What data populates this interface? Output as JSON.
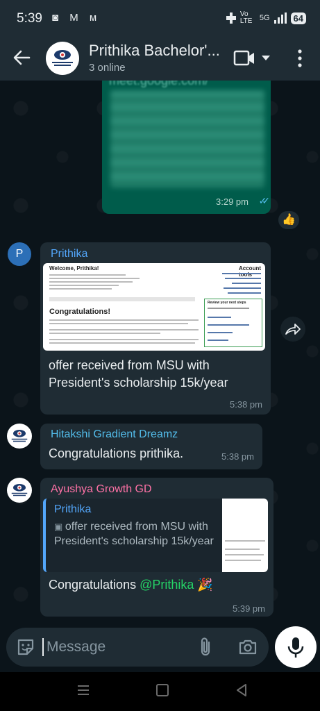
{
  "status_bar": {
    "time": "5:39",
    "left_icons": "◙ M ᴍ",
    "signal_text": "Vo LTE",
    "network": "5G",
    "battery": "64"
  },
  "header": {
    "title": "Prithika Bachelor'...",
    "subtitle": "3 online",
    "avatar_text": "GRADIENT DREAMZ"
  },
  "messages": [
    {
      "type": "outgoing",
      "link_text": "meet.google.com/",
      "time": "3:29 pm",
      "reaction": "👍"
    },
    {
      "type": "incoming",
      "avatar_letter": "P",
      "sender": "Prithika",
      "sender_color": "#53a6fa",
      "preview": {
        "title": "Welcome, Prithika!",
        "headline": "Congratulations!",
        "side_title": "Account tools",
        "box_title": "Review your next steps"
      },
      "text": "offer received from MSU with President's scholarship 15k/year",
      "time": "5:38 pm"
    },
    {
      "type": "incoming",
      "sender": "Hitakshi Gradient Dreamz",
      "sender_color": "#53bdeb",
      "text": "Congratulations prithika.",
      "time": "5:38 pm"
    },
    {
      "type": "incoming",
      "sender": "Ayushya Growth GD",
      "sender_color": "#ff72a6",
      "quote": {
        "name": "Prithika",
        "text": "offer received from MSU with President's scholarship 15k/year"
      },
      "text": "Congratulations",
      "mention": "@Prithika",
      "emoji": "🎉",
      "time": "5:39 pm"
    }
  ],
  "input": {
    "placeholder": "Message"
  },
  "colors": {
    "header_bg": "#1f2c34",
    "chat_bg": "#0b141a",
    "outgoing_bubble": "#005c4b",
    "incoming_bubble": "#1f2c34",
    "read_ticks": "#53bdeb",
    "mention": "#25d366"
  }
}
